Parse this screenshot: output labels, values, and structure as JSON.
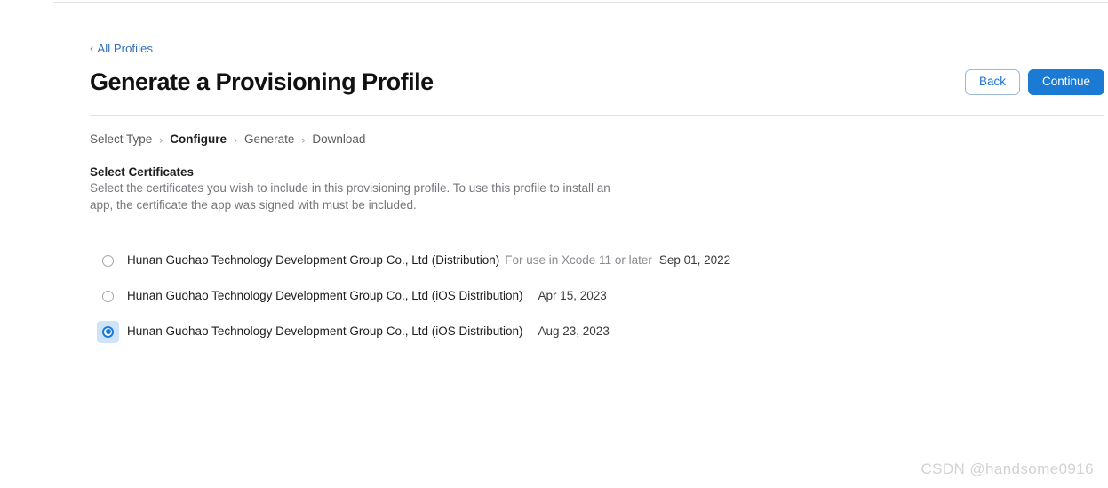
{
  "header": {
    "back_link": "All Profiles",
    "back_chevron_icon": "chevron-left-icon",
    "title": "Generate a Provisioning Profile",
    "back_button": "Back",
    "continue_button": "Continue",
    "accent_color": "#1b7ad4",
    "link_color": "#2f6fb5"
  },
  "steps": {
    "separator": "›",
    "items": [
      {
        "label": "Select Type",
        "active": false
      },
      {
        "label": "Configure",
        "active": true
      },
      {
        "label": "Generate",
        "active": false
      },
      {
        "label": "Download",
        "active": false
      }
    ]
  },
  "section": {
    "title": "Select Certificates",
    "description": "Select the certificates you wish to include in this provisioning profile. To use this profile to install an app, the certificate the app was signed with must be included."
  },
  "certificates": [
    {
      "name": "Hunan Guohao Technology Development Group Co., Ltd (Distribution)",
      "note": "For use in Xcode 11 or later",
      "date": "Sep 01, 2022",
      "selected": false,
      "focused": false
    },
    {
      "name": "Hunan Guohao Technology Development Group Co., Ltd (iOS Distribution)",
      "note": "",
      "date": "Apr 15, 2023",
      "selected": false,
      "focused": false
    },
    {
      "name": "Hunan Guohao Technology Development Group Co., Ltd (iOS Distribution)",
      "note": "",
      "date": "Aug 23, 2023",
      "selected": true,
      "focused": true
    }
  ],
  "watermark": "CSDN @handsome0916"
}
